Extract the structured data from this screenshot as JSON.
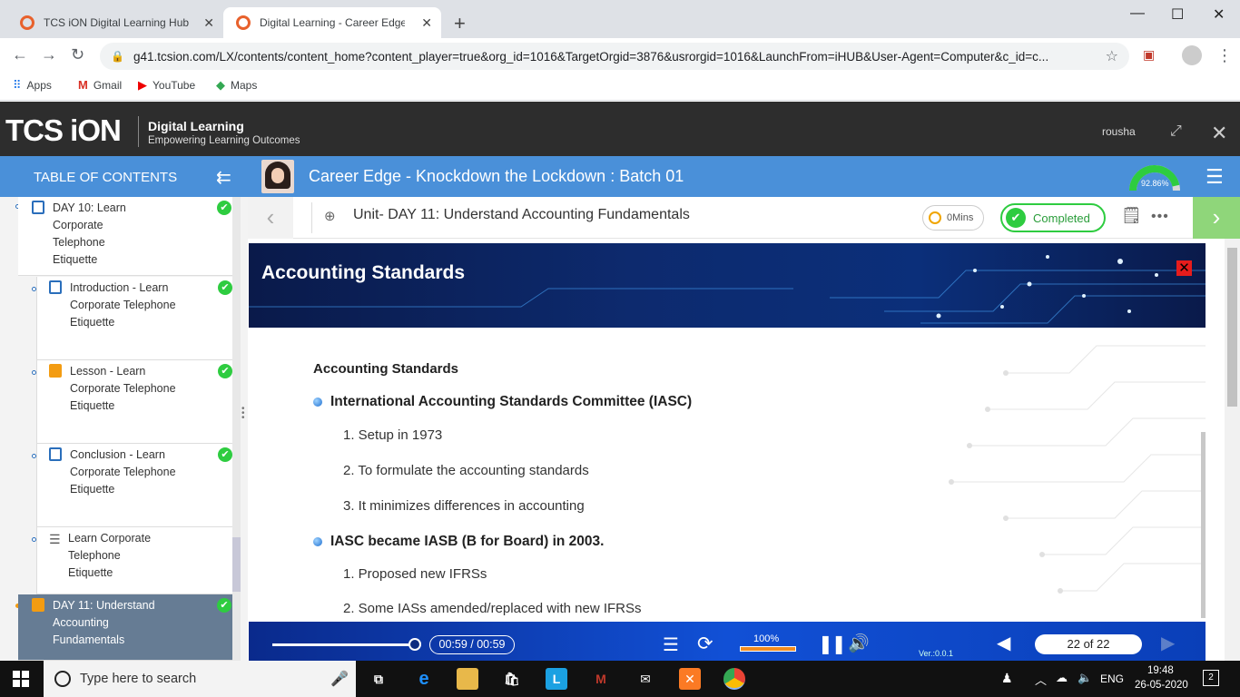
{
  "browser": {
    "tabs": [
      {
        "title": "TCS iON Digital Learning Hub",
        "active": false
      },
      {
        "title": "Digital Learning - Career Edge - K",
        "active": true
      }
    ],
    "url": "g41.tcsion.com/LX/contents/content_home?content_player=true&org_id=1016&TargetOrgid=3876&usrorgid=1016&LaunchFrom=iHUB&User-Agent=Computer&c_id=c...",
    "bookmarks": [
      "Apps",
      "Gmail",
      "YouTube",
      "Maps"
    ]
  },
  "header": {
    "logo": "TCS iON",
    "brand_title": "Digital Learning",
    "brand_subtitle": "Empowering Learning Outcomes",
    "username": "rousha"
  },
  "sidebar": {
    "title": "TABLE OF CONTENTS",
    "items": [
      {
        "label": "DAY 10: Learn Corporate Telephone Etiquette",
        "completed": true
      },
      {
        "label": "Introduction - Learn Corporate Telephone Etiquette",
        "completed": true
      },
      {
        "label": "Lesson - Learn Corporate Telephone Etiquette",
        "completed": true
      },
      {
        "label": "Conclusion - Learn Corporate Telephone Etiquette",
        "completed": true
      },
      {
        "label": "Learn Corporate Telephone Etiquette",
        "completed": false
      },
      {
        "label": "DAY 11: Understand Accounting Fundamentals",
        "completed": true
      }
    ]
  },
  "course": {
    "title": "Career Edge - Knockdown the Lockdown : Batch 01",
    "progress_label": "92.86%",
    "progress": 0.9286
  },
  "unit": {
    "title": "Unit- DAY 11: Understand Accounting Fundamentals",
    "time": "0Mins",
    "status": "Completed"
  },
  "slide": {
    "banner_title": "Accounting Standards",
    "heading": "Accounting Standards",
    "bullet1": "International Accounting Standards Committee (IASC)",
    "list1": [
      "1. Setup in 1973",
      "2. To formulate the accounting standards",
      "3. It minimizes differences in accounting"
    ],
    "bullet2": "IASC became IASB (B for Board) in 2003.",
    "list2": [
      "1. Proposed new IFRSs",
      "2. Some IASs amended/replaced with new IFRSs"
    ]
  },
  "player": {
    "timecode": "00:59 / 00:59",
    "speed": "100%",
    "version": "Ver.:0.0.1",
    "page": "22 of 22"
  },
  "taskbar": {
    "search_placeholder": "Type here to search",
    "language": "ENG",
    "time": "19:48",
    "date": "26-05-2020",
    "notifications": "2"
  },
  "colors": {
    "accent": "#4a90d9",
    "completed": "#2ecc40",
    "header_bg": "#2d2d2d",
    "banner_bg": "#0d2a6e"
  }
}
